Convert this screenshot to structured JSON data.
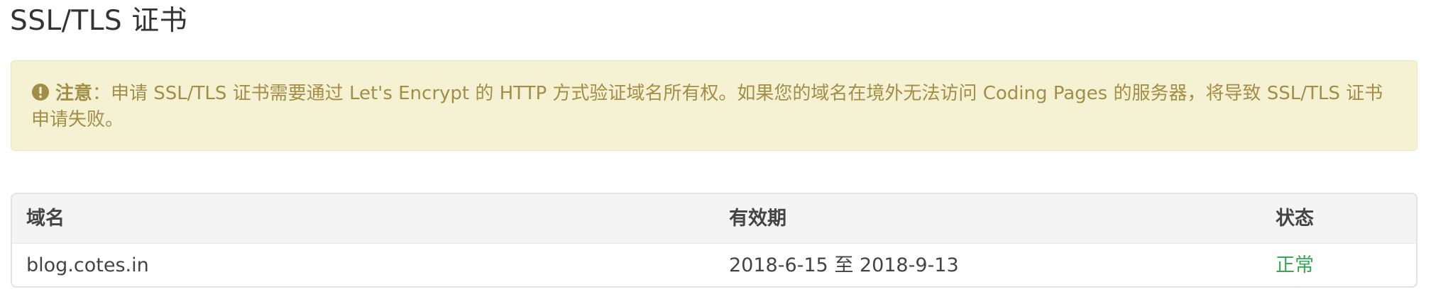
{
  "page": {
    "title": "SSL/TLS 证书"
  },
  "notice": {
    "icon": "exclamation-circle-icon",
    "label": "注意",
    "separator": "：",
    "message": "申请 SSL/TLS 证书需要通过 Let's Encrypt 的 HTTP 方式验证域名所有权。如果您的域名在境外无法访问 Coding Pages 的服务器，将导致 SSL/TLS 证书申请失败。",
    "colors": {
      "background": "#f5f1d3",
      "text": "#a38e48"
    }
  },
  "table": {
    "headers": {
      "domain": "域名",
      "validity": "有效期",
      "status": "状态"
    },
    "rows": [
      {
        "domain": "blog.cotes.in",
        "validity": "2018-6-15 至 2018-9-13",
        "status": "正常",
        "status_color": "#3aa757"
      }
    ]
  }
}
